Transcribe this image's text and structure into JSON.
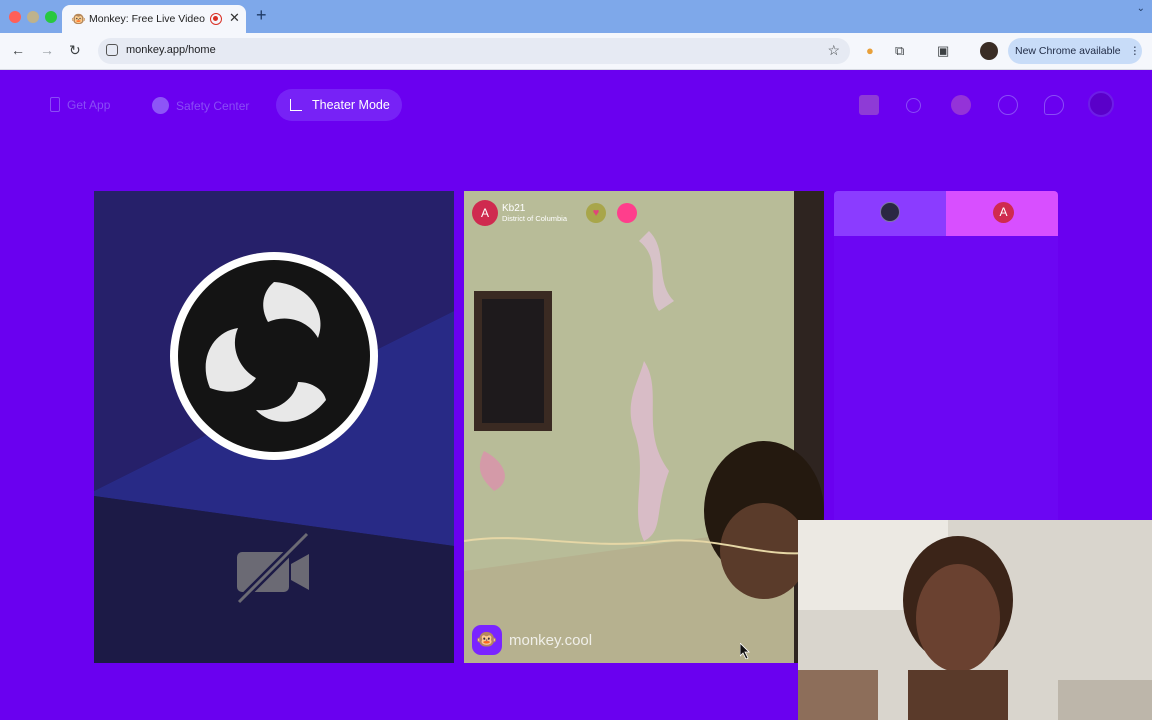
{
  "browser": {
    "tab_title": "Monkey: Free Live Video Chat",
    "tab_favicon": "monkey-emoji-icon",
    "url": "monkey.app/home",
    "new_chrome_label": "New Chrome available"
  },
  "header": {
    "get_app_label": "Get App",
    "safety_center_label": "Safety Center",
    "theater_mode_label": "Theater Mode",
    "icons": [
      "shop-icon",
      "search-icon",
      "globe-icon",
      "history-icon",
      "chat-icon",
      "profile-icon"
    ]
  },
  "remote_user": {
    "avatar_letter": "A",
    "name": "Kb21",
    "location": "District of Columbia"
  },
  "watermark_text": "monkey.cool",
  "right_panel": {
    "avatar_letter": "A"
  },
  "colors": {
    "background": "#6a00f0",
    "accent_tab": "#8b3cff",
    "accent_pink": "#d84fff",
    "avatar": "#cf2a4f"
  }
}
